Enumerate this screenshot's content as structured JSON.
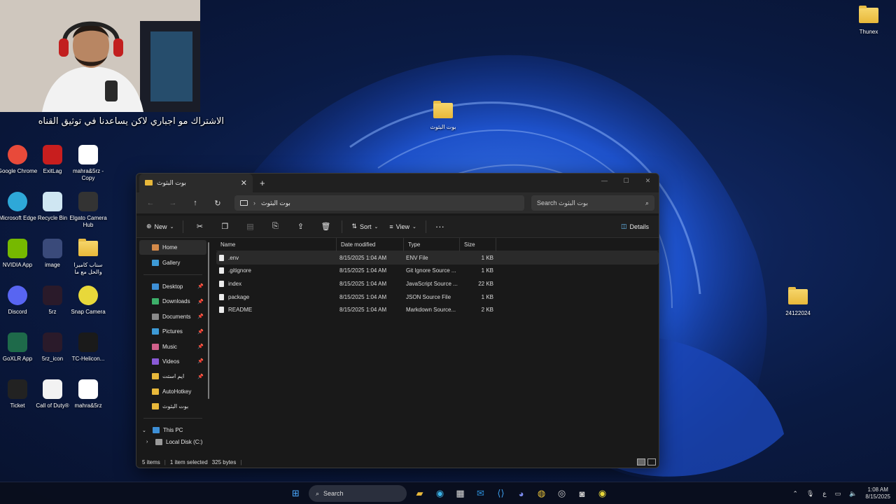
{
  "caption": "الاشتراك مو اجباري لاكن يساعدنا في توثيق القناه",
  "desktop": {
    "icons": [
      {
        "label": "Google Chrome",
        "icon": "chrome-icon"
      },
      {
        "label": "ExitLag",
        "icon": "exitlag-icon"
      },
      {
        "label": "mahra&5rz - Copy",
        "icon": "h-app-icon"
      },
      {
        "label": "Microsoft Edge",
        "icon": "edge-icon"
      },
      {
        "label": "Recycle Bin",
        "icon": "recycle-bin-icon"
      },
      {
        "label": "Elgato Camera Hub",
        "icon": "camera-icon"
      },
      {
        "label": "NVIDIA App",
        "icon": "nvidia-icon"
      },
      {
        "label": "image",
        "icon": "image-icon"
      },
      {
        "label": "سناب كاميرا والحل مع ما",
        "icon": "folder-icon"
      },
      {
        "label": "Discord",
        "icon": "discord-icon"
      },
      {
        "label": "5rz",
        "icon": "5rz-icon"
      },
      {
        "label": "Snap Camera",
        "icon": "snap-camera-icon"
      },
      {
        "label": "GoXLR App",
        "icon": "goxlr-icon"
      },
      {
        "label": "5rz_icon",
        "icon": "5rz-icon"
      },
      {
        "label": "TC-Helicon...",
        "icon": "tc-helicon-icon"
      },
      {
        "label": "Ticket",
        "icon": "ticket-icon"
      },
      {
        "label": "Call of Duty®",
        "icon": "file-icon"
      },
      {
        "label": "mahra&5rz",
        "icon": "h-app-icon"
      }
    ],
    "folder_center": "بوت البثوث",
    "folder_right": "24122024",
    "folder_top_right": "Thunex"
  },
  "explorer": {
    "tab_title": "بوت البثوث",
    "breadcrumb": "بوت البثوث",
    "search_placeholder": "Search بوت البثوث",
    "toolbar": {
      "new": "New",
      "sort": "Sort",
      "view": "View",
      "details": "Details"
    },
    "nav": {
      "home": "Home",
      "gallery": "Gallery",
      "quick": [
        {
          "label": "Desktop",
          "color": "#3d8fd6"
        },
        {
          "label": "Downloads",
          "color": "#3db06a"
        },
        {
          "label": "Documents",
          "color": "#8a8a8a"
        },
        {
          "label": "Pictures",
          "color": "#3d9ad6"
        },
        {
          "label": "Music",
          "color": "#d0608a"
        },
        {
          "label": "Videos",
          "color": "#8a5ad6"
        },
        {
          "label": "ايم استت",
          "color": "#e8b83a"
        },
        {
          "label": "AutoHotkey",
          "color": "#e8b83a"
        },
        {
          "label": "بوت البثوث",
          "color": "#e8b83a"
        }
      ],
      "this_pc": "This PC",
      "local_disk": "Local Disk (C:)"
    },
    "columns": {
      "name": "Name",
      "date": "Date modified",
      "type": "Type",
      "size": "Size"
    },
    "files": [
      {
        "name": ".env",
        "date": "8/15/2025 1:04 AM",
        "type": "ENV File",
        "size": "1 KB"
      },
      {
        "name": ".gitignore",
        "date": "8/15/2025 1:04 AM",
        "type": "Git Ignore Source ...",
        "size": "1 KB"
      },
      {
        "name": "index",
        "date": "8/15/2025 1:04 AM",
        "type": "JavaScript Source ...",
        "size": "22 KB"
      },
      {
        "name": "package",
        "date": "8/15/2025 1:04 AM",
        "type": "JSON Source File",
        "size": "1 KB"
      },
      {
        "name": "README",
        "date": "8/15/2025 1:04 AM",
        "type": "Markdown Source...",
        "size": "2 KB"
      }
    ],
    "status": {
      "items": "5 items",
      "selected": "1 item selected",
      "bytes": "325 bytes"
    }
  },
  "taskbar": {
    "search": "Search",
    "time": "1:08 AM",
    "date": "8/15/2025",
    "lang": "ع"
  }
}
